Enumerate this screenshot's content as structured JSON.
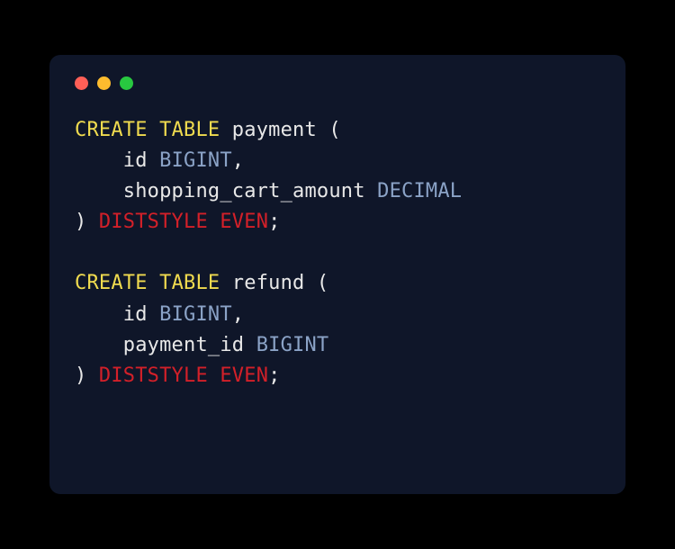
{
  "code": {
    "line1": {
      "create": "CREATE",
      "table": "TABLE",
      "name": " payment ",
      "open": "("
    },
    "line2": {
      "indent": "    ",
      "col": "id ",
      "type": "BIGINT",
      "comma": ","
    },
    "line3": {
      "indent": "    ",
      "col": "shopping_cart_amount ",
      "type": "DECIMAL"
    },
    "line4": {
      "close": ") ",
      "diststyle": "DISTSTYLE",
      "space": " ",
      "even": "EVEN",
      "semi": ";"
    },
    "line5": "",
    "line6": {
      "create": "CREATE",
      "table": "TABLE",
      "name": " refund ",
      "open": "("
    },
    "line7": {
      "indent": "    ",
      "col": "id ",
      "type": "BIGINT",
      "comma": ","
    },
    "line8": {
      "indent": "    ",
      "col": "payment_id ",
      "type": "BIGINT"
    },
    "line9": {
      "close": ") ",
      "diststyle": "DISTSTYLE",
      "space": " ",
      "even": "EVEN",
      "semi": ";"
    }
  }
}
